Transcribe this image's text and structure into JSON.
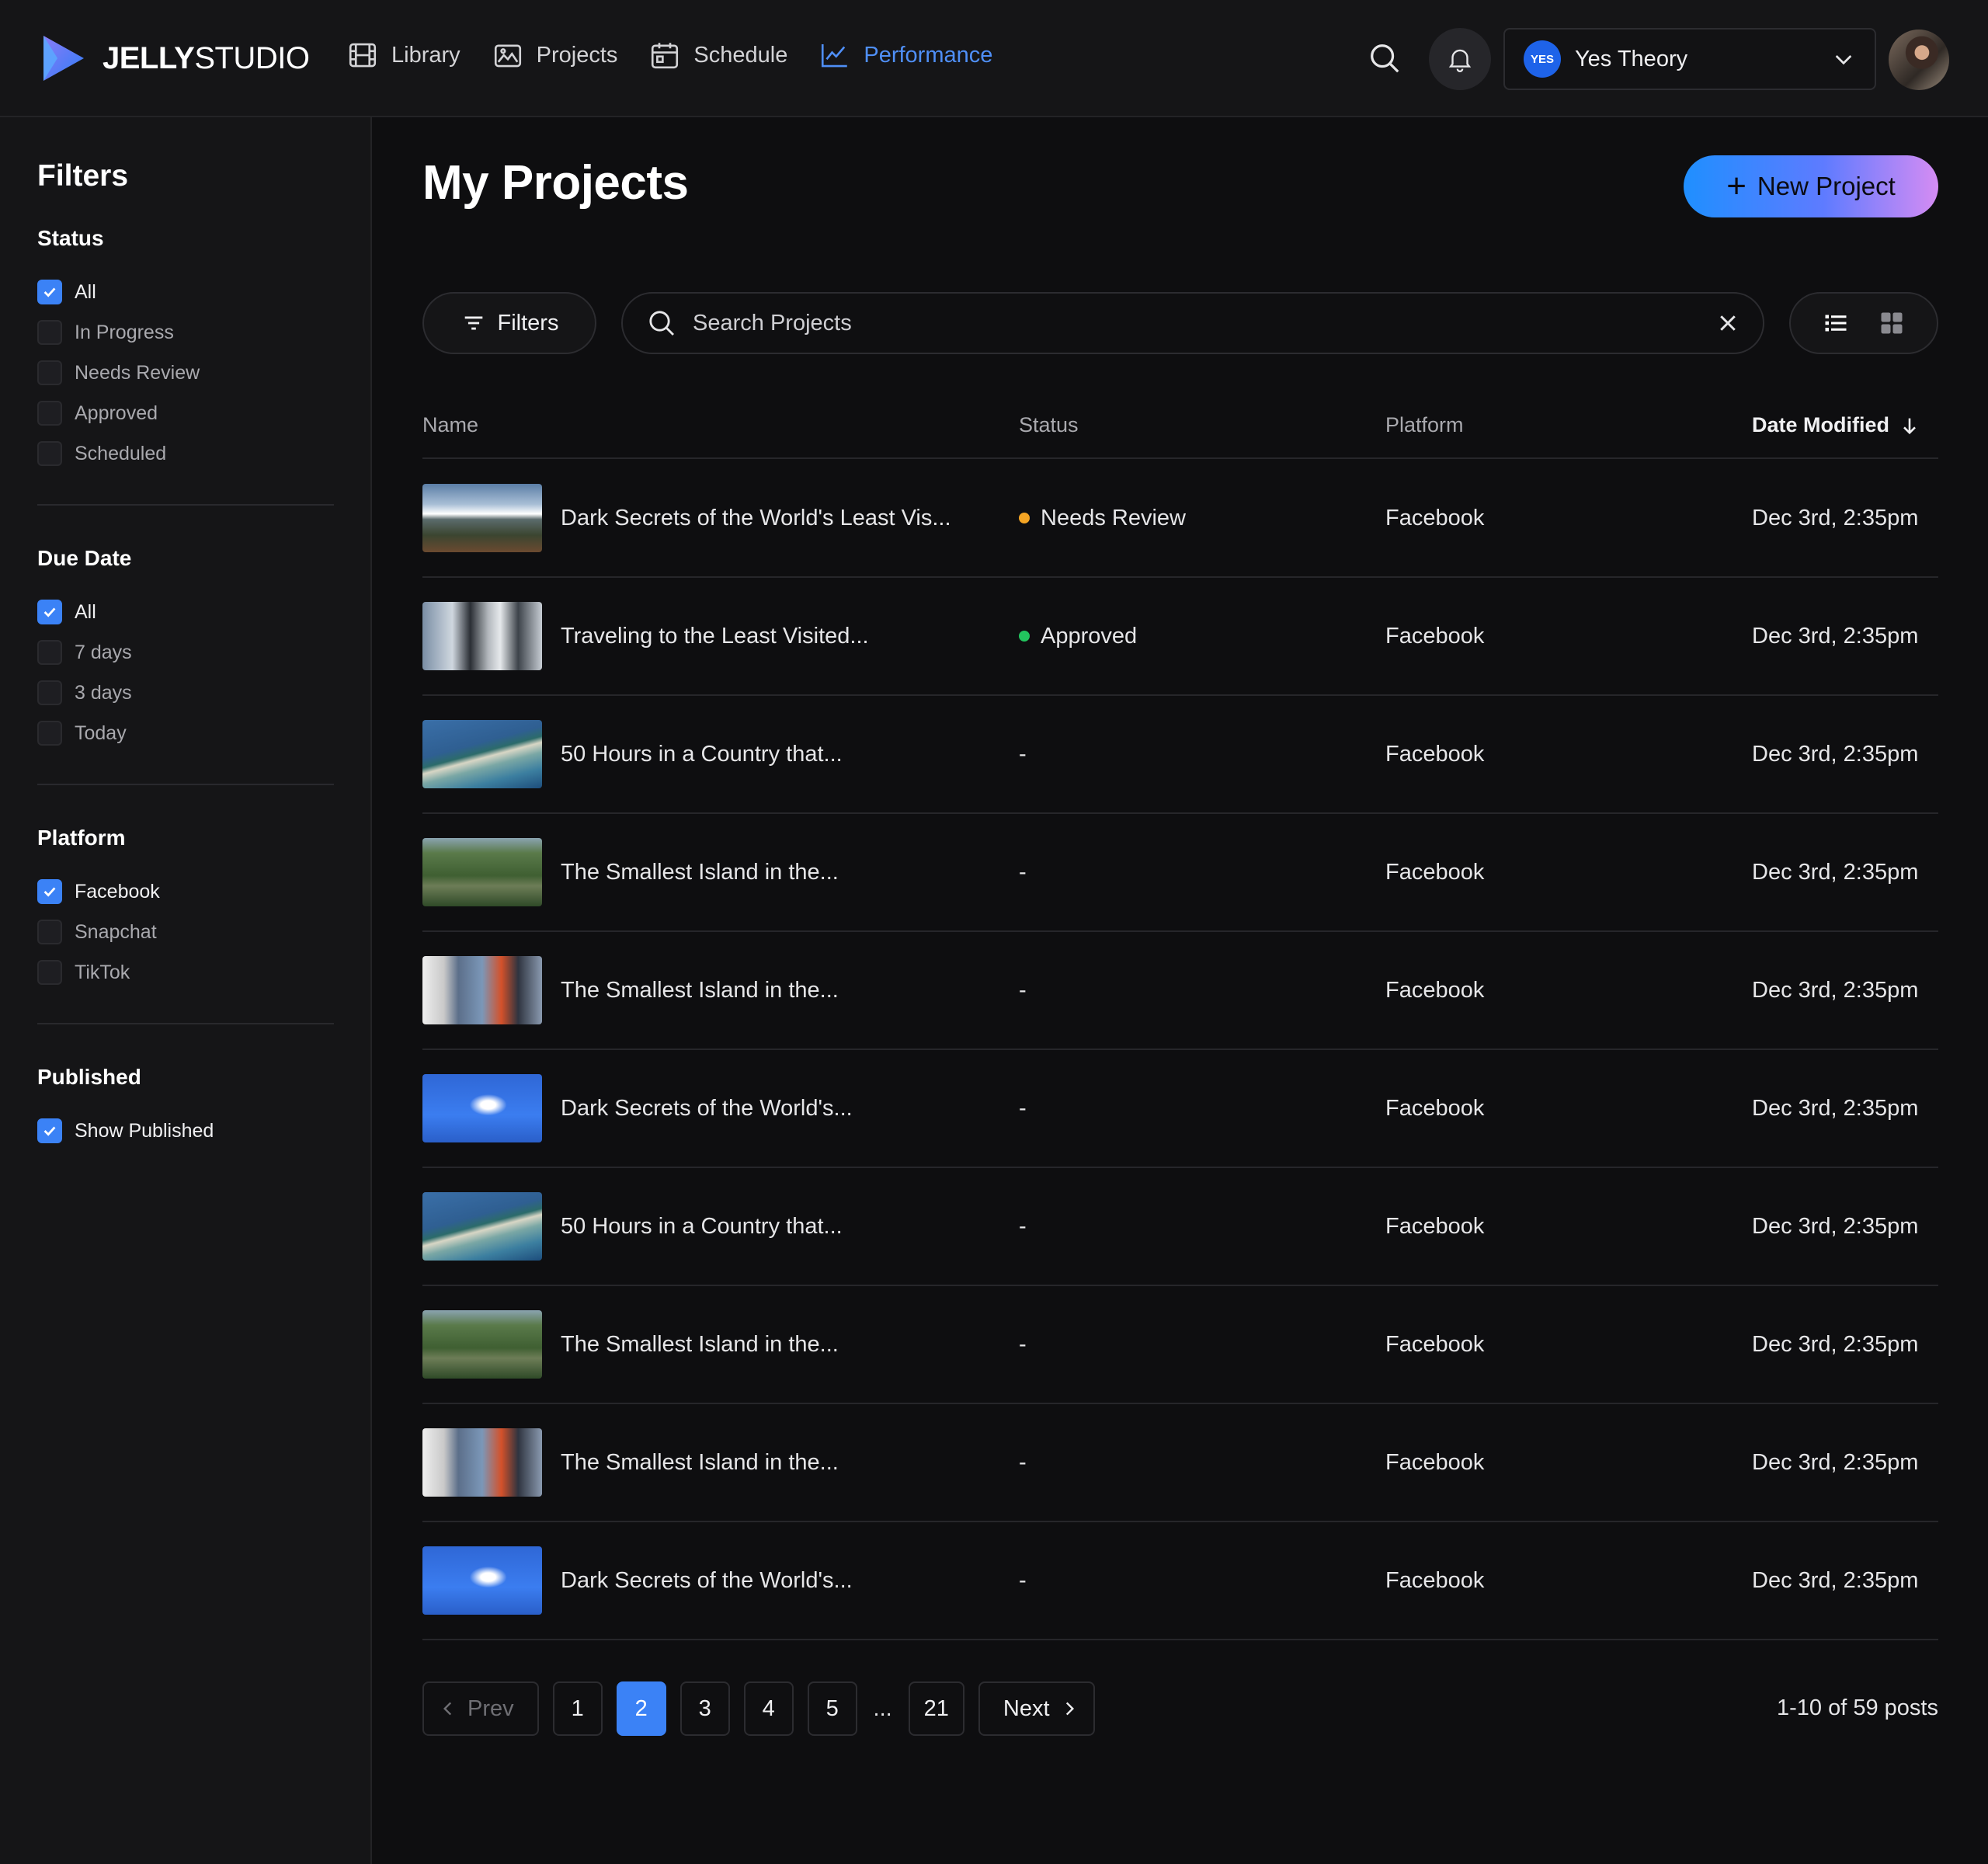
{
  "brand": {
    "name_bold": "JELLY",
    "name_light": "STUDIO"
  },
  "nav": [
    {
      "label": "Library",
      "icon": "film-icon"
    },
    {
      "label": "Projects",
      "icon": "image-icon"
    },
    {
      "label": "Schedule",
      "icon": "calendar-icon"
    },
    {
      "label": "Performance",
      "icon": "chart-line-icon",
      "active": true
    }
  ],
  "account": {
    "badge": "YES",
    "name": "Yes Theory"
  },
  "sidebar": {
    "title": "Filters",
    "status": {
      "title": "Status",
      "options": [
        "All",
        "In Progress",
        "Needs Review",
        "Approved",
        "Scheduled"
      ]
    },
    "due_date": {
      "title": "Due Date",
      "options": [
        "All",
        "7 days",
        "3 days",
        "Today"
      ]
    },
    "platform": {
      "title": "Platform",
      "options": [
        "Facebook",
        "Snapchat",
        "TikTok"
      ]
    },
    "published": {
      "title": "Published",
      "options": [
        "Show Published"
      ]
    }
  },
  "main": {
    "title": "My Projects",
    "new_project_label": "New Project",
    "filters_label": "Filters",
    "search_placeholder": "Search Projects"
  },
  "table": {
    "columns": {
      "name": "Name",
      "status": "Status",
      "platform": "Platform",
      "date": "Date Modified"
    },
    "rows": [
      {
        "name": "Dark Secrets of the World's Least Vis...",
        "status": "Needs Review",
        "platform": "Facebook",
        "date": "Dec 3rd, 2:35pm"
      },
      {
        "name": "Traveling to the Least Visited...",
        "status": "Approved",
        "platform": "Facebook",
        "date": "Dec 3rd, 2:35pm"
      },
      {
        "name": "50 Hours in a Country that...",
        "status": "-",
        "platform": "Facebook",
        "date": "Dec 3rd, 2:35pm"
      },
      {
        "name": "The Smallest Island in the...",
        "status": "-",
        "platform": "Facebook",
        "date": "Dec 3rd, 2:35pm"
      },
      {
        "name": "The Smallest Island in the...",
        "status": "-",
        "platform": "Facebook",
        "date": "Dec 3rd, 2:35pm"
      },
      {
        "name": "Dark Secrets of the World's...",
        "status": "-",
        "platform": "Facebook",
        "date": "Dec 3rd, 2:35pm"
      },
      {
        "name": "50 Hours in a Country that...",
        "status": "-",
        "platform": "Facebook",
        "date": "Dec 3rd, 2:35pm"
      },
      {
        "name": "The Smallest Island in the...",
        "status": "-",
        "platform": "Facebook",
        "date": "Dec 3rd, 2:35pm"
      },
      {
        "name": "The Smallest Island in the...",
        "status": "-",
        "platform": "Facebook",
        "date": "Dec 3rd, 2:35pm"
      },
      {
        "name": "Dark Secrets of the World's...",
        "status": "-",
        "platform": "Facebook",
        "date": "Dec 3rd, 2:35pm"
      }
    ]
  },
  "pagination": {
    "prev": "Prev",
    "next": "Next",
    "pages": [
      "1",
      "2",
      "3",
      "4",
      "5"
    ],
    "ellipsis": "...",
    "last": "21",
    "summary": "1-10 of 59 posts"
  },
  "colors": {
    "accent": "#3b82f6",
    "needs_review": "#f5a524",
    "approved": "#22c55e"
  }
}
